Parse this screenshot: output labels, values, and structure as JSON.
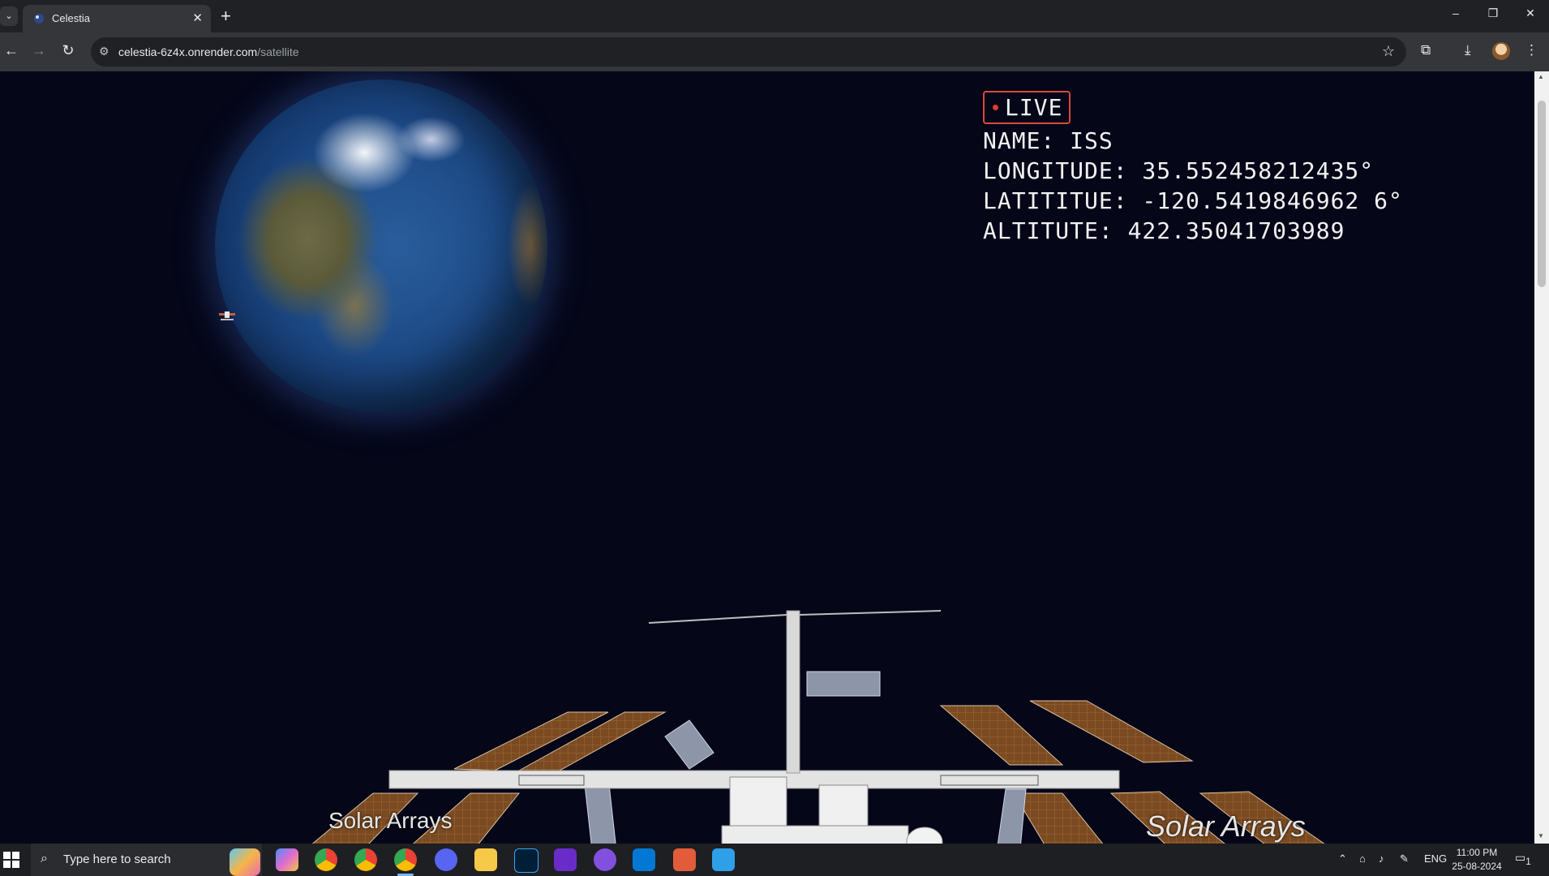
{
  "browser": {
    "tab_title": "Celestia",
    "url_host": "celestia-6z4x.onrender.com",
    "url_path": "/satellite"
  },
  "satellite": {
    "live_label": "LIVE",
    "name_line": "NAME: ISS",
    "longitude_line": "LONGITUDE: 35.552458212435°",
    "latitude_line": "LATITITUE: -120.5419846962 6°",
    "altitude_line": "ALTITUTE: 422.35041703989"
  },
  "scene": {
    "label_left": "Solar Arrays",
    "label_right": "Solar Arrays"
  },
  "taskbar": {
    "search_placeholder": "Type here to search",
    "language": "ENG",
    "time": "11:00 PM",
    "date": "25-08-2024",
    "notification_count": "1",
    "apps": [
      "copilot-icon",
      "chrome-icon",
      "chrome-icon",
      "chrome-icon",
      "discord-icon",
      "file-explorer-icon",
      "photoshop-icon",
      "nzxt-icon",
      "github-icon",
      "vscode-icon",
      "snipping-tool-icon",
      "paint-icon"
    ]
  },
  "colors": {
    "background": "#050618",
    "live_border": "#d84a3a",
    "live_dot": "#e23b2e",
    "text": "#f2f2f2"
  }
}
